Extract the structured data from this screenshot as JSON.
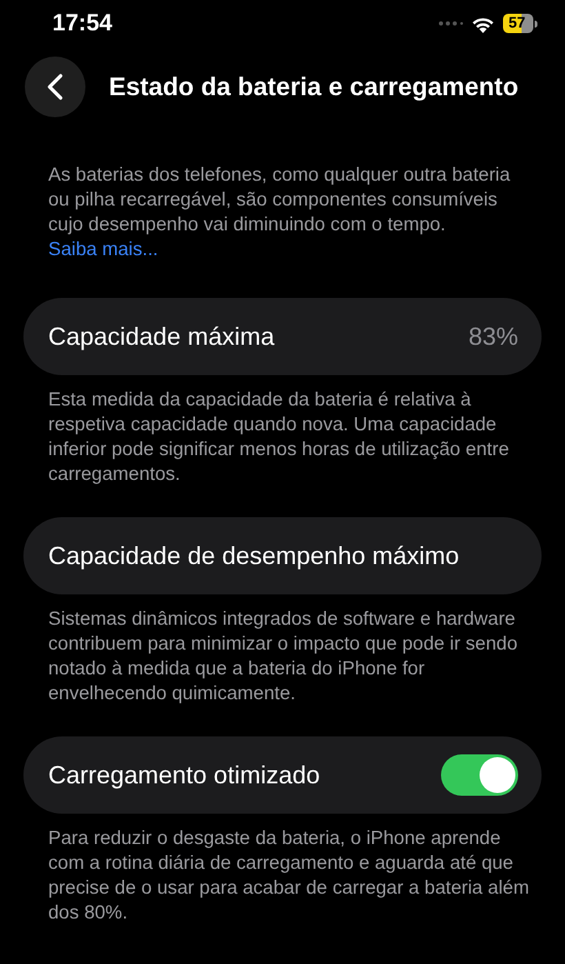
{
  "status_bar": {
    "time": "17:54",
    "battery": "57"
  },
  "nav": {
    "title": "Estado da bateria e carregamento"
  },
  "intro": {
    "text": "As baterias dos telefones, como qualquer outra bateria ou pilha recarregável, são componentes consumíveis cujo desempenho vai diminuindo com o tempo.",
    "link": "Saiba mais..."
  },
  "rows": [
    {
      "kind": "value",
      "label": "Capacidade máxima",
      "value": "83%",
      "footer": "Esta medida da capacidade da bateria é relativa à respetiva capacidade quando nova. Uma capacidade inferior pode significar menos horas de utilização entre carregamentos."
    },
    {
      "kind": "plain",
      "label": "Capacidade de desempenho máximo",
      "footer": "Sistemas dinâmicos integrados de software e hardware contribuem para minimizar o impacto que pode ir sendo notado à medida que a bateria do iPhone for envelhecendo quimicamente."
    },
    {
      "kind": "toggle",
      "label": "Carregamento otimizado",
      "on": true,
      "footer": "Para reduzir o desgaste da bateria, o iPhone aprende com a rotina diária de carregamento e aguarda até que precise de o usar para acabar de carregar a bateria além dos 80%."
    }
  ]
}
